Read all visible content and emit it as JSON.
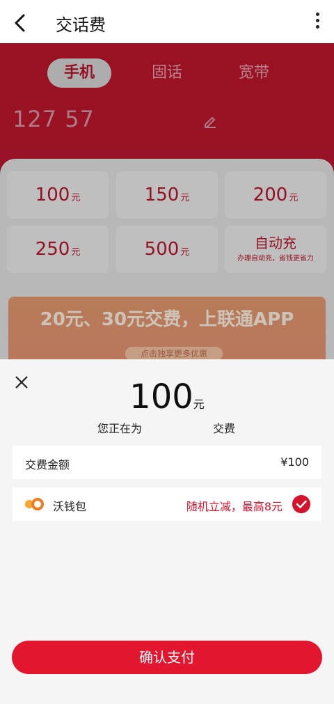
{
  "header": {
    "title": "交话费"
  },
  "tabs": [
    {
      "label": "手机"
    },
    {
      "label": "固话"
    },
    {
      "label": "宽带"
    }
  ],
  "phone_number": "127 57",
  "amounts": [
    {
      "value": "100",
      "unit": "元"
    },
    {
      "value": "150",
      "unit": "元"
    },
    {
      "value": "200",
      "unit": "元"
    },
    {
      "value": "250",
      "unit": "元"
    },
    {
      "value": "500",
      "unit": "元"
    }
  ],
  "auto_recharge": {
    "label": "自动充",
    "sub": "办理自动充，省钱更省力"
  },
  "banner": {
    "title": "20元、30元交费，上联通APP",
    "button": "点击独享更多优惠"
  },
  "sheet": {
    "amount": "100",
    "unit": "元",
    "paying_for_prefix": "您正在为",
    "paying_for_suffix": "交费",
    "fee_label": "交费金额",
    "fee_value": "¥100",
    "wallet_label": "沃钱包",
    "promo": "随机立减，最高8元",
    "confirm_button": "确认支付"
  },
  "colors": {
    "brand_red": "#d4142c",
    "header_bg": "#ffffff"
  }
}
